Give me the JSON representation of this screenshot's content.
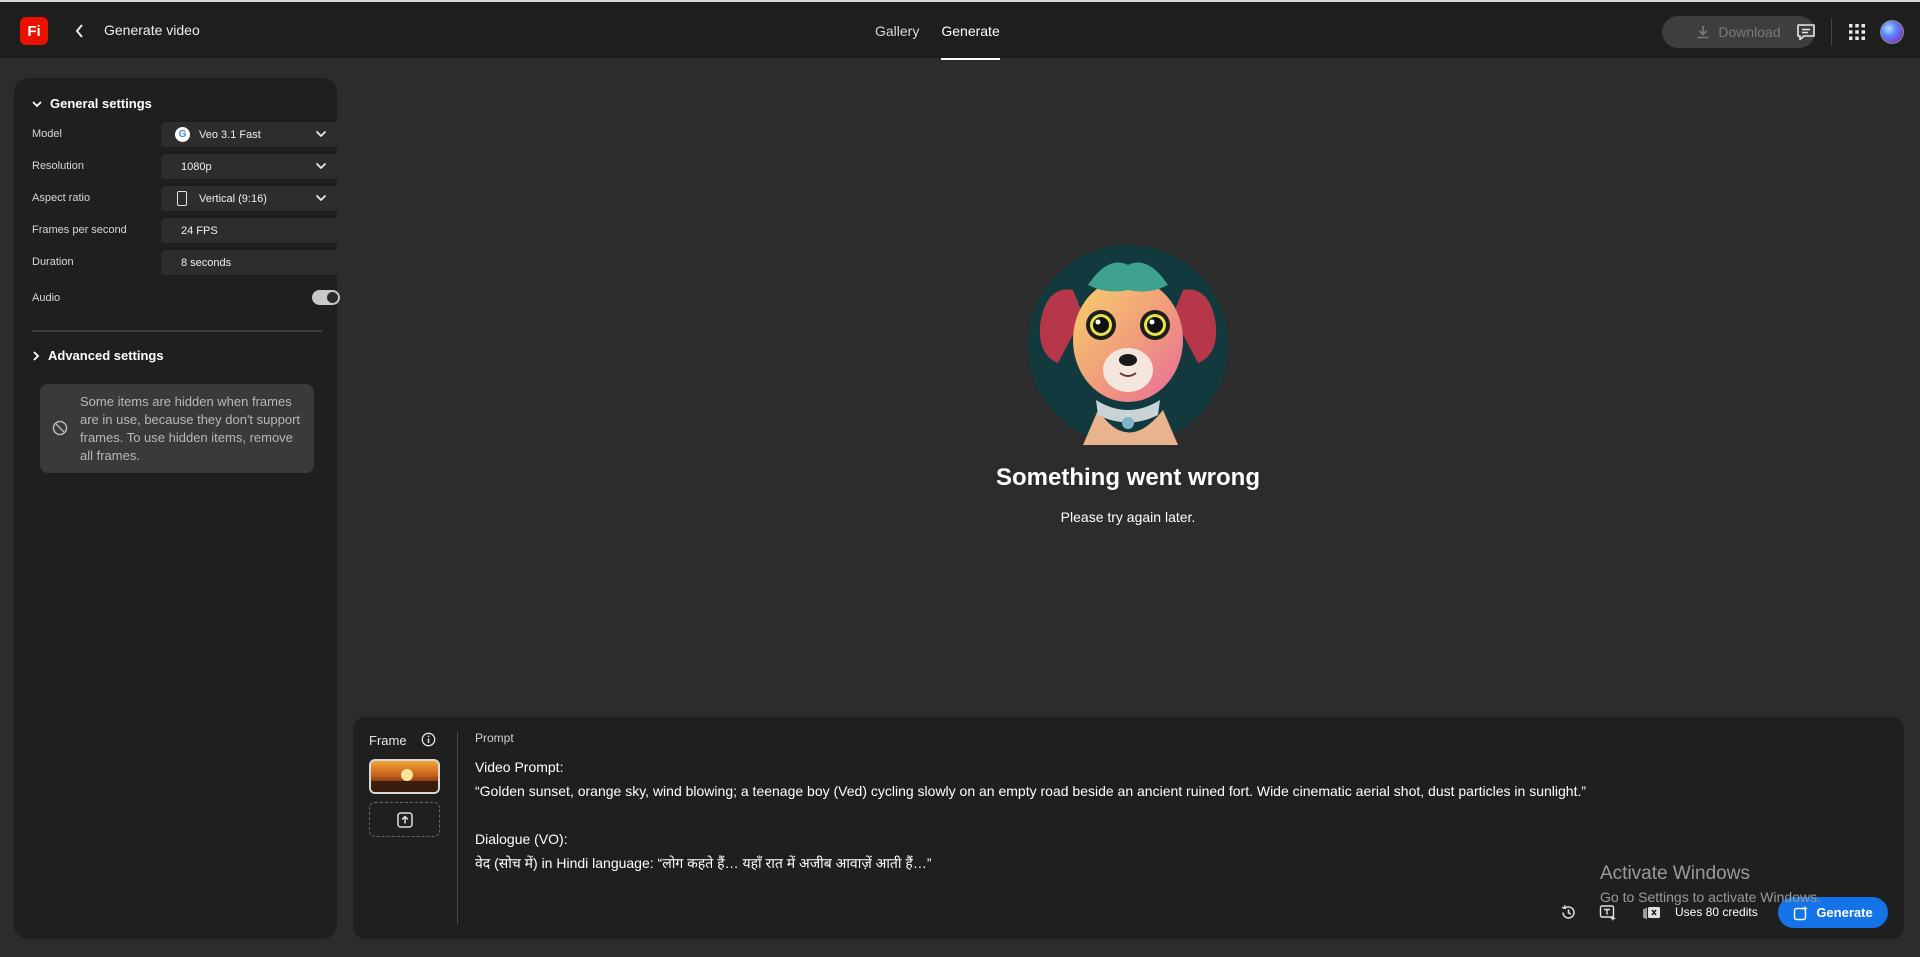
{
  "app": {
    "logo_text": "Fi",
    "page_title": "Generate video"
  },
  "nav": {
    "tabs": [
      {
        "label": "Gallery",
        "active": false
      },
      {
        "label": "Generate",
        "active": true
      }
    ]
  },
  "toolbar": {
    "download_label": "Download",
    "download_enabled": false,
    "icons": [
      "comment-icon",
      "apps-grid-icon",
      "user-avatar"
    ]
  },
  "settings": {
    "general_header": "General settings",
    "rows": [
      {
        "label": "Model",
        "value": "Veo 3.1 Fast",
        "icon": "google-g-icon",
        "dropdown": true
      },
      {
        "label": "Resolution",
        "value": "1080p",
        "dropdown": true
      },
      {
        "label": "Aspect ratio",
        "value": "Vertical (9:16)",
        "icon": "phone-portrait-icon",
        "dropdown": true
      },
      {
        "label": "Frames per second",
        "value": "24 FPS",
        "dropdown": false
      },
      {
        "label": "Duration",
        "value": "8 seconds",
        "dropdown": false
      }
    ],
    "audio_label": "Audio",
    "audio_enabled": true,
    "advanced_header": "Advanced settings",
    "notice_text": "Some items are hidden when frames are in use, because they don't support frames. To use hidden items, remove all frames."
  },
  "main": {
    "error_title": "Something went wrong",
    "error_subtitle": "Please try again later."
  },
  "prompt": {
    "frame_label": "Frame",
    "label": "Prompt",
    "text": "Video Prompt:\n“Golden sunset, orange sky, wind blowing; a teenage boy (Ved) cycling slowly on an empty road beside an ancient ruined fort. Wide cinematic aerial shot, dust particles in sunlight.”\n\nDialogue (VO):\nवेद (सोच में) in Hindi language: “लोग कहते हैं… यहाँ रात में अजीब आवाज़ें आती हैं…”",
    "credits_label": "Uses 80 credits",
    "generate_label": "Generate"
  },
  "watermark": {
    "line1": "Activate Windows",
    "line2": "Go to Settings to activate Windows."
  },
  "colors": {
    "accent": "#1473e6",
    "brand": "#eb1000",
    "background": "#2c2c2c",
    "panel": "#1f1f1f"
  }
}
